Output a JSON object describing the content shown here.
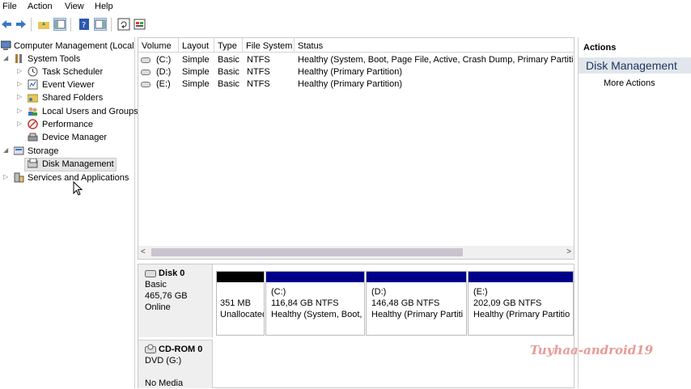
{
  "menu": [
    "File",
    "Action",
    "View",
    "Help"
  ],
  "tree": {
    "root": "Computer Management (Local",
    "system_tools": "System Tools",
    "task_scheduler": "Task Scheduler",
    "event_viewer": "Event Viewer",
    "shared_folders": "Shared Folders",
    "local_users": "Local Users and Groups",
    "performance": "Performance",
    "device_manager": "Device Manager",
    "storage": "Storage",
    "disk_management": "Disk Management",
    "services": "Services and Applications"
  },
  "list": {
    "headers": [
      "Volume",
      "Layout",
      "Type",
      "File System",
      "Status"
    ],
    "rows": [
      {
        "volume": "(C:)",
        "layout": "Simple",
        "type": "Basic",
        "fs": "NTFS",
        "status": "Healthy (System, Boot, Page File, Active, Crash Dump, Primary Partition"
      },
      {
        "volume": "(D:)",
        "layout": "Simple",
        "type": "Basic",
        "fs": "NTFS",
        "status": "Healthy (Primary Partition)"
      },
      {
        "volume": "(E:)",
        "layout": "Simple",
        "type": "Basic",
        "fs": "NTFS",
        "status": "Healthy (Primary Partition)"
      }
    ]
  },
  "disk0": {
    "name": "Disk 0",
    "type": "Basic",
    "size": "465,76 GB",
    "state": "Online",
    "partitions": [
      {
        "title": "",
        "size": "351 MB",
        "status": "Unallocated",
        "color": "#000000"
      },
      {
        "title": "(C:)",
        "size": "116,84 GB NTFS",
        "status": "Healthy (System, Boot,",
        "color": "#00008b"
      },
      {
        "title": "(D:)",
        "size": "146,48 GB NTFS",
        "status": "Healthy (Primary Partiti",
        "color": "#00008b"
      },
      {
        "title": "(E:)",
        "size": "202,09 GB NTFS",
        "status": "Healthy (Primary Partitio",
        "color": "#00008b"
      }
    ]
  },
  "cdrom": {
    "name": "CD-ROM 0",
    "drive": "DVD (G:)",
    "media": "No Media"
  },
  "actions": {
    "title": "Actions",
    "section": "Disk Management",
    "more": "More Actions"
  },
  "watermark": "Tuyhaa-android19",
  "colors": {
    "primary_partition": "#00008b",
    "unallocated": "#000000",
    "actions_highlight": "#e1e6ec"
  }
}
